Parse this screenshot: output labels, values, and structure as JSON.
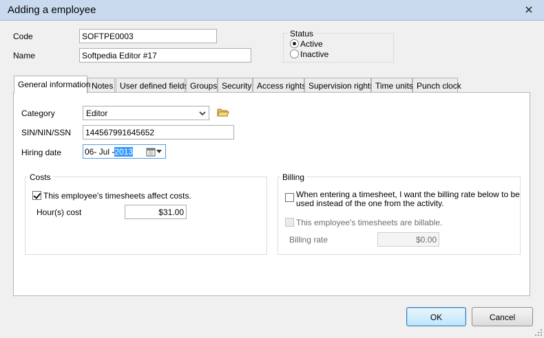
{
  "window": {
    "title": "Adding a employee"
  },
  "fields": {
    "code_label": "Code",
    "code_value": "SOFTPE0003",
    "name_label": "Name",
    "name_value": "Softpedia Editor #17"
  },
  "status": {
    "title": "Status",
    "active_label": "Active",
    "inactive_label": "Inactive",
    "selected": "Active"
  },
  "tabs": [
    {
      "label": "General information"
    },
    {
      "label": "Notes"
    },
    {
      "label": "User defined fields"
    },
    {
      "label": "Groups"
    },
    {
      "label": "Security"
    },
    {
      "label": "Access rights"
    },
    {
      "label": "Supervision rights"
    },
    {
      "label": "Time units"
    },
    {
      "label": "Punch clock"
    }
  ],
  "general": {
    "category_label": "Category",
    "category_value": "Editor",
    "sin_label": "SIN/NIN/SSN",
    "sin_value": "144567991645652",
    "hiring_label": "Hiring date",
    "hiring_day_month": "06- Jul -",
    "hiring_year": "2013"
  },
  "costs": {
    "title": "Costs",
    "affect_label": "This employee's timesheets affect costs.",
    "affect_checked": true,
    "hour_cost_label": "Hour(s) cost",
    "hour_cost_value": "$31.00"
  },
  "billing": {
    "title": "Billing",
    "override_label_line1": "When entering a timesheet, I want the billing rate below to be",
    "override_label_line2": "used instead of the one from the activity.",
    "billable_label": "This employee's timesheets are billable.",
    "rate_label": "Billing rate",
    "rate_value": "$0.00"
  },
  "buttons": {
    "ok": "OK",
    "cancel": "Cancel"
  },
  "colors": {
    "titlebar": "#c9daef",
    "selection": "#3399ff",
    "default_button": "#bee6fd"
  }
}
